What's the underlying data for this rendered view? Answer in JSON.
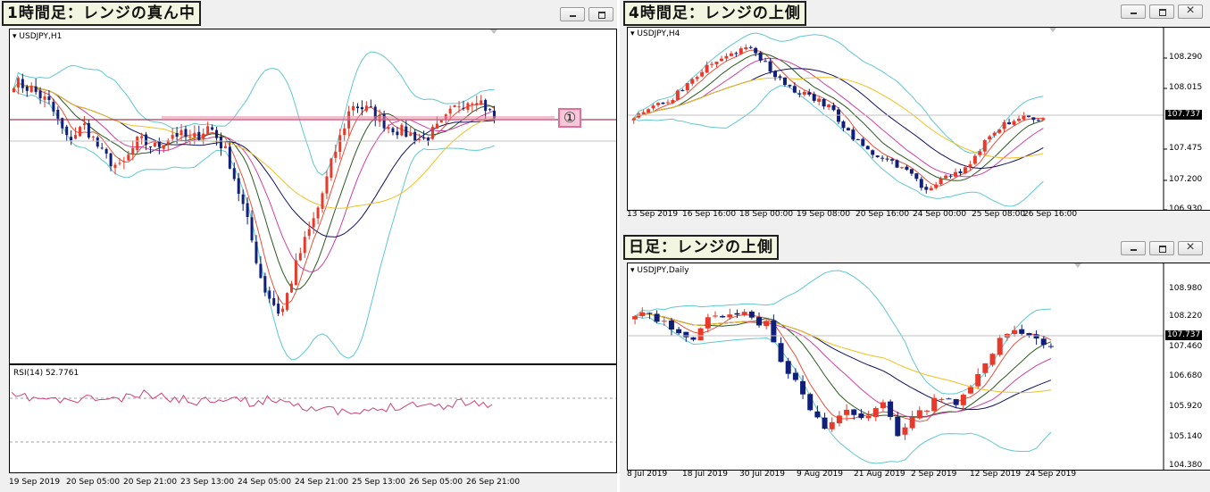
{
  "windows": {
    "h1": {
      "title": "1時間足：レンジの真ん中",
      "symbol": "USDJPY,H1",
      "rsi_label": "RSI(14) 52.7761",
      "marker": "①",
      "x_labels": [
        "19 Sep 2019",
        "20 Sep 05:00",
        "20 Sep 21:00",
        "23 Sep 13:00",
        "24 Sep 05:00",
        "24 Sep 21:00",
        "25 Sep 13:00",
        "26 Sep 05:00",
        "26 Sep 21:00"
      ]
    },
    "h4": {
      "title": "4時間足：レンジの上側",
      "symbol": "USDJPY,H4",
      "price_labels": [
        "108.290",
        "108.015",
        "107.475",
        "107.200",
        "106.930"
      ],
      "current_price": "107.737",
      "x_labels": [
        "13 Sep 2019",
        "16 Sep 16:00",
        "18 Sep 00:00",
        "19 Sep 08:00",
        "20 Sep 16:00",
        "24 Sep 00:00",
        "25 Sep 08:00",
        "26 Sep 16:00"
      ]
    },
    "daily": {
      "title": "日足：レンジの上側",
      "symbol": "USDJPY,Daily",
      "price_labels": [
        "108.980",
        "108.220",
        "107.460",
        "106.680",
        "105.920",
        "105.140",
        "104.380"
      ],
      "current_price": "107.737",
      "x_labels": [
        "8 Jul 2019",
        "18 Jul 2019",
        "30 Jul 2019",
        "9 Aug 2019",
        "21 Aug 2019",
        "2 Sep 2019",
        "12 Sep 2019",
        "24 Sep 2019"
      ]
    }
  },
  "colors": {
    "bull": "#e8392a",
    "bear": "#10207a",
    "band": "#5fc8d0",
    "rsi": "#d0407a",
    "hline": "#8b1030",
    "ma_orange": "#e8503a",
    "ma_green": "#2a5a20",
    "ma_pink": "#d040a0",
    "ma_navy": "#101060",
    "ma_yellow": "#f0c020"
  },
  "chart_data": [
    {
      "type": "candlestick",
      "title": "USDJPY,H1",
      "x": [
        "19 Sep 2019",
        "20 Sep 05:00",
        "20 Sep 21:00",
        "23 Sep 13:00",
        "24 Sep 05:00",
        "24 Sep 21:00",
        "25 Sep 13:00",
        "26 Sep 05:00",
        "26 Sep 21:00"
      ],
      "indicators": [
        "Bollinger Bands",
        "Moving Averages",
        "RSI(14)"
      ],
      "rsi_last": 52.7761
    },
    {
      "type": "candlestick",
      "title": "USDJPY,H4",
      "ylim": [
        106.93,
        108.29
      ],
      "last": 107.737
    },
    {
      "type": "candlestick",
      "title": "USDJPY,Daily",
      "ylim": [
        104.38,
        108.98
      ],
      "last": 107.737
    }
  ]
}
